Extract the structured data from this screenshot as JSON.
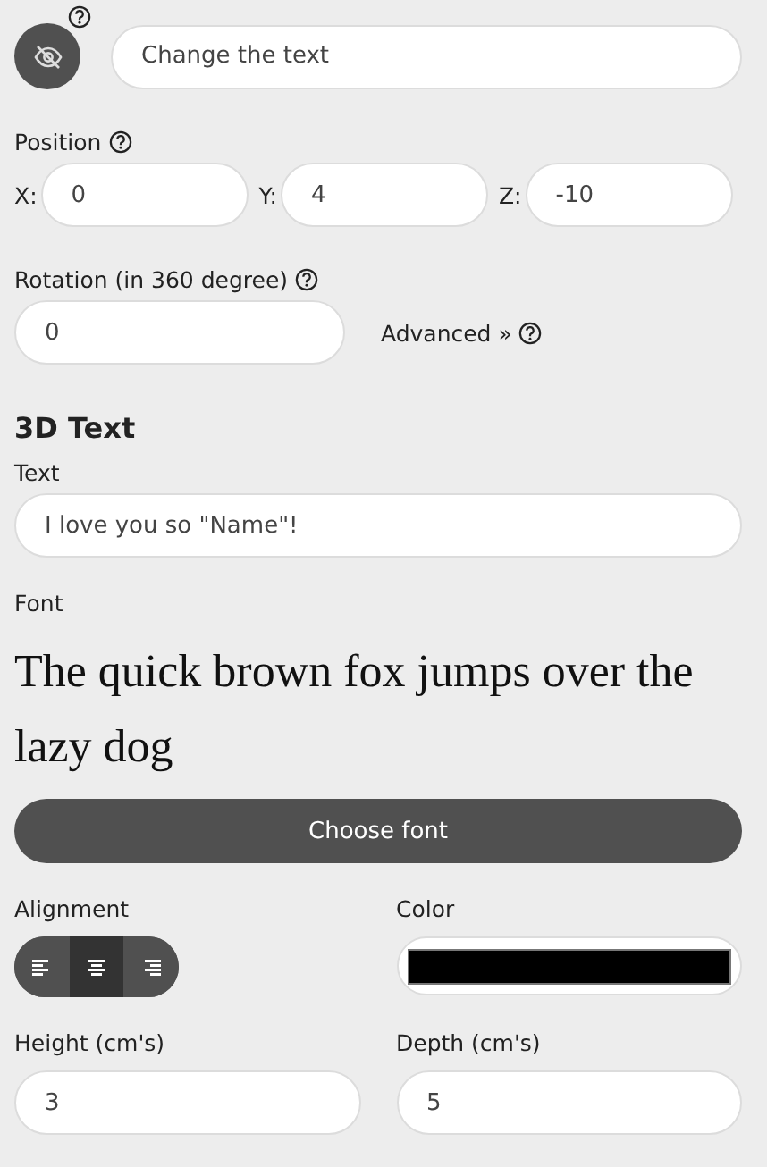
{
  "name_field": {
    "placeholder": "Change the text"
  },
  "position": {
    "label": "Position",
    "fields": [
      {
        "label": "X:",
        "value": "0"
      },
      {
        "label": "Y:",
        "value": "4"
      },
      {
        "label": "Z:",
        "value": "-10"
      }
    ]
  },
  "rotation": {
    "label": "Rotation (in 360 degree)",
    "value": "0",
    "advanced": "Advanced »"
  },
  "section_title": "3D Text",
  "text": {
    "label": "Text",
    "value": "I love you so \"Name\"!"
  },
  "font": {
    "label": "Font",
    "sample": "The quick brown fox jumps over the lazy dog",
    "button": "Choose font"
  },
  "alignment": {
    "label": "Alignment",
    "options": [
      {
        "kind": "left",
        "selected": false
      },
      {
        "kind": "center",
        "selected": true
      },
      {
        "kind": "right",
        "selected": false
      }
    ]
  },
  "color": {
    "label": "Color",
    "color": "#000000"
  },
  "height": {
    "label": "Height (cm's)",
    "value": "3"
  },
  "depth": {
    "label": "Depth (cm's)",
    "value": "5"
  }
}
